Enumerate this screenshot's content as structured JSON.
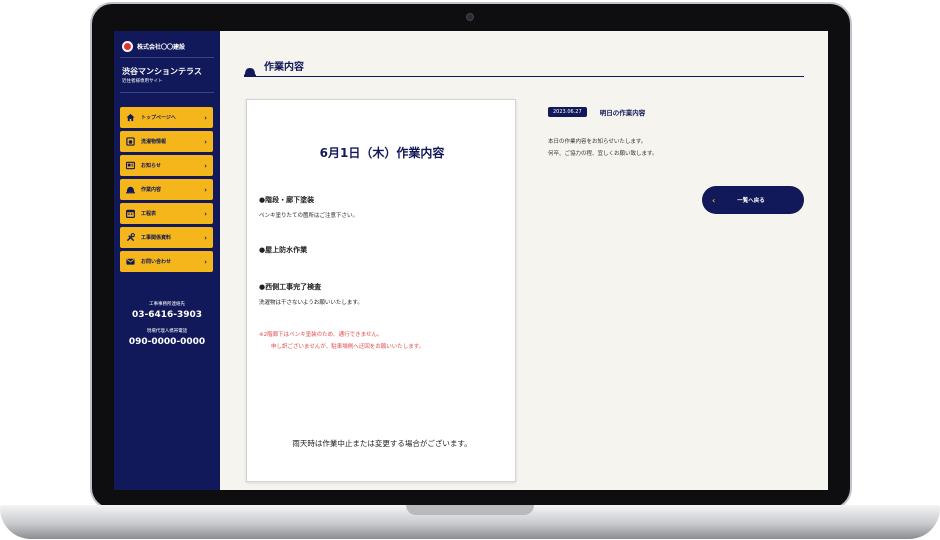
{
  "sidebar": {
    "company": "株式会社〇〇建設",
    "property_name": "渋谷マンションテラス",
    "property_sub": "近住者様専用サイト",
    "items": [
      {
        "label": "トップページへ",
        "icon": "home-icon"
      },
      {
        "label": "洗濯物情報",
        "icon": "laundry-icon"
      },
      {
        "label": "お知らせ",
        "icon": "news-icon"
      },
      {
        "label": "作業内容",
        "icon": "helmet-icon"
      },
      {
        "label": "工程表",
        "icon": "calendar-icon"
      },
      {
        "label": "工事関係資料",
        "icon": "tools-icon"
      },
      {
        "label": "お問い合わせ",
        "icon": "mail-icon"
      }
    ],
    "chevron": "›",
    "contact_label_1": "工事事務所連絡先",
    "contact_phone_1": "03-6416-3903",
    "contact_label_2": "現場代理人携帯電話",
    "contact_phone_2": "090-0000-0000"
  },
  "header": {
    "title": "作業内容"
  },
  "paper": {
    "title": "6月1日（木）作業内容",
    "item1": "●階段・廊下塗装",
    "desc1": "ペンキ塗りたての箇所はご注意下さい。",
    "item2": "●屋上防水作業",
    "item3": "●西側工事完了検査",
    "desc3": "洗濯物は干さないようお願いいたします。",
    "note1": "※2階廊下はペンキ塗装のため、通行できません。",
    "note2": "申し訳ございませんが、駐車場側へ迂回をお願いいたします。",
    "footer": "雨天時は作業中止または変更する場合がございます。"
  },
  "detail": {
    "date": "2023.06.27",
    "title": "明日の作業内容",
    "body1": "本日の作業内容をお知らせいたします。",
    "body2": "何卒、ご協力の程、宜しくお願い致します。",
    "back_label": "一覧へ戻る",
    "back_chevron": "‹"
  },
  "colors": {
    "navy": "#12195a",
    "accent": "#f4b61b",
    "alert": "#e54a4a"
  }
}
